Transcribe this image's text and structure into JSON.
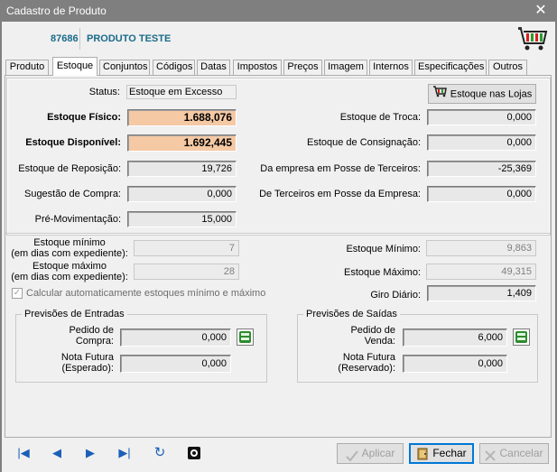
{
  "window": {
    "title": "Cadastro de Produto",
    "close_glyph": "✕"
  },
  "product": {
    "code": "87686",
    "name": "PRODUTO TESTE"
  },
  "tabs": [
    {
      "label": "Produto",
      "active": false
    },
    {
      "label": "Estoque",
      "active": true
    },
    {
      "label": "Conjuntos",
      "active": false
    },
    {
      "label": "Códigos",
      "active": false
    },
    {
      "label": "Datas",
      "active": false
    },
    {
      "label": "Impostos",
      "active": false
    },
    {
      "label": "Preços",
      "active": false
    },
    {
      "label": "Imagem",
      "active": false
    },
    {
      "label": "Internos",
      "active": false
    },
    {
      "label": "Especificações",
      "active": false
    },
    {
      "label": "Outros",
      "active": false
    }
  ],
  "stock": {
    "status_label": "Status:",
    "status_value": "Estoque em Excesso",
    "stores_button": "Estoque nas Lojas",
    "fisico_label": "Estoque Físico:",
    "fisico_value": "1.688,076",
    "disponivel_label": "Estoque Disponível:",
    "disponivel_value": "1.692,445",
    "reposicao_label": "Estoque de Reposição:",
    "reposicao_value": "19,726",
    "sugestao_label": "Sugestão de Compra:",
    "sugestao_value": "0,000",
    "premov_label": "Pré-Movimentação:",
    "premov_value": "15,000",
    "troca_label": "Estoque de Troca:",
    "troca_value": "0,000",
    "consignacao_label": "Estoque de Consignação:",
    "consignacao_value": "0,000",
    "posse_terceiros_label": "Da empresa em Posse de Terceiros:",
    "posse_terceiros_value": "-25,369",
    "terceiros_posse_label": "De Terceiros em Posse da Empresa:",
    "terceiros_posse_value": "0,000"
  },
  "limits": {
    "min_days_label_1": "Estoque mínimo",
    "min_days_label_2": "(em dias com expediente):",
    "min_days_value": "7",
    "max_days_label_1": "Estoque máximo",
    "max_days_label_2": "(em dias com expediente):",
    "max_days_value": "28",
    "auto_calc_label": "Calcular automaticamente estoques mínimo e máximo",
    "auto_calc_checked": true,
    "min_label": "Estoque Mínimo:",
    "min_value": "9,863",
    "max_label": "Estoque Máximo:",
    "max_value": "49,315",
    "giro_label": "Giro Diário:",
    "giro_value": "1,409"
  },
  "entradas": {
    "title": "Previsões de Entradas",
    "pedido_label_1": "Pedido de",
    "pedido_label_2": "Compra:",
    "pedido_value": "0,000",
    "nota_label_1": "Nota Futura",
    "nota_label_2": "(Esperado):",
    "nota_value": "0,000"
  },
  "saidas": {
    "title": "Previsões de Saídas",
    "pedido_label_1": "Pedido de",
    "pedido_label_2": "Venda:",
    "pedido_value": "6,000",
    "nota_label_1": "Nota Futura",
    "nota_label_2": "(Reservado):",
    "nota_value": "0,000"
  },
  "footer": {
    "nav_first": "|◀",
    "nav_prev": "◀",
    "nav_next": "▶",
    "nav_last": "▶|",
    "refresh": "↻",
    "aplicar": "Aplicar",
    "fechar": "Fechar",
    "cancelar": "Cancelar"
  },
  "colors": {
    "title_bar": "#7f7f7f",
    "highlight_field": "#f4c9a4",
    "product_text": "#1a6b8a",
    "nav_blue": "#1b5fb8"
  }
}
